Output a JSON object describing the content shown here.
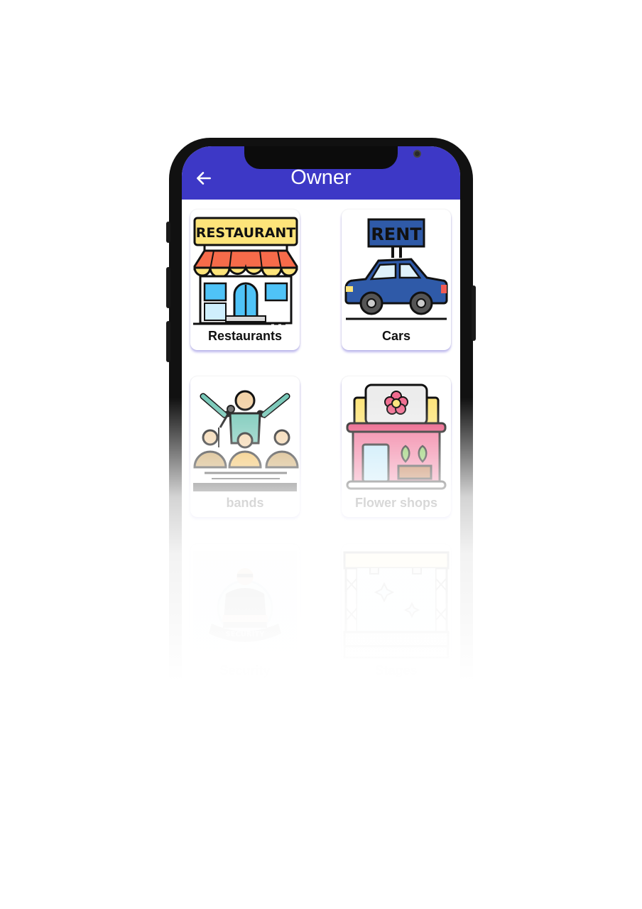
{
  "app": {
    "title": "Owner",
    "accent": "#3d38c6"
  },
  "icons": {
    "back": "arrow-left-icon"
  },
  "categories": [
    {
      "label": "Restaurants",
      "icon": "restaurant-icon",
      "sign": "RESTAURANT"
    },
    {
      "label": "Cars",
      "icon": "rent-car-icon",
      "sign": "RENT"
    },
    {
      "label": "bands",
      "icon": "band-icon"
    },
    {
      "label": "Flower shops",
      "icon": "flower-shop-icon"
    },
    {
      "label": "Security",
      "icon": "security-guard-icon",
      "badge": "SECURITY"
    },
    {
      "label": "Stages",
      "icon": "stage-icon"
    }
  ],
  "bottom_nav": [
    {
      "icon": "ticket-icon"
    },
    {
      "icon": "shop-icon"
    },
    {
      "icon": "add-icon",
      "label": "+"
    },
    {
      "icon": "home-icon"
    },
    {
      "icon": "calendar-icon"
    }
  ]
}
